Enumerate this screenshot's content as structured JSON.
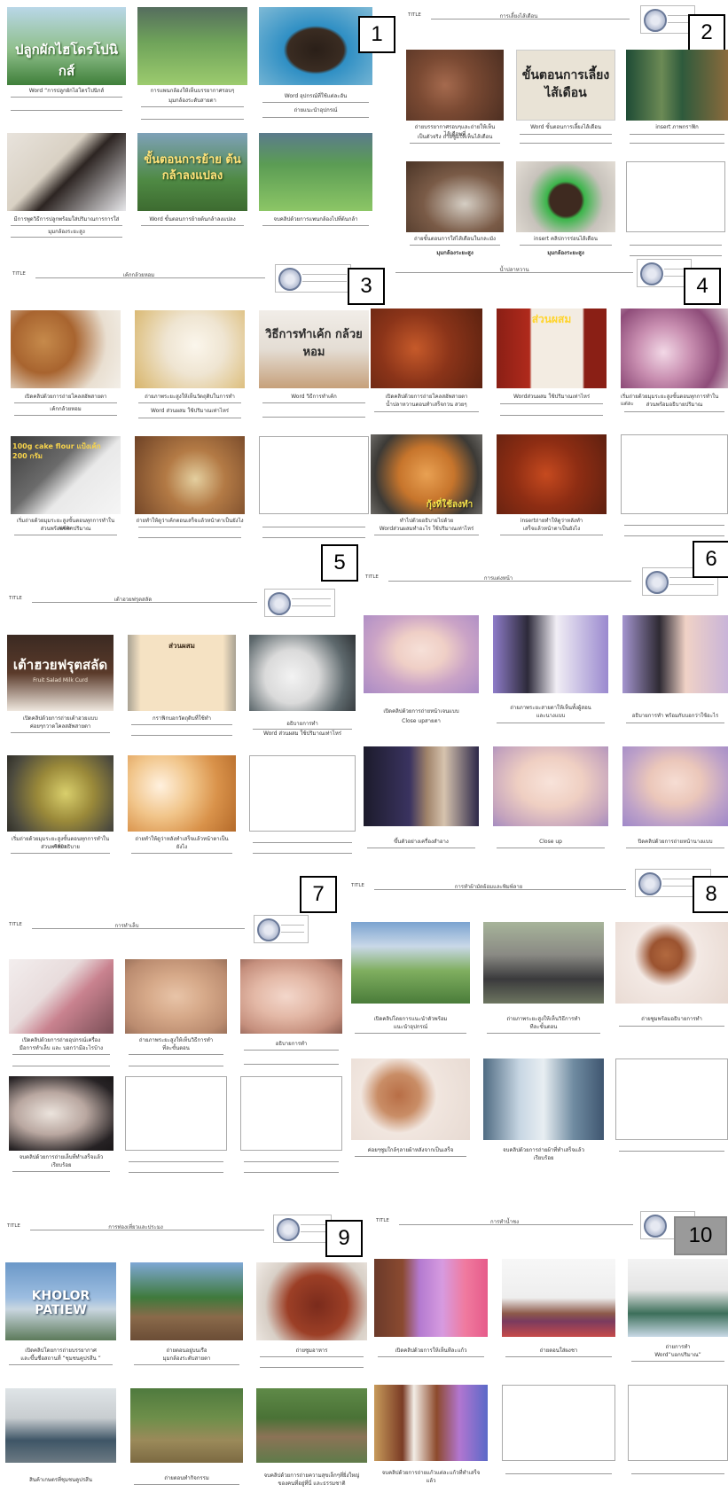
{
  "panel_numbers": [
    "1",
    "2",
    "3",
    "4",
    "5",
    "6",
    "7",
    "8",
    "9",
    "10"
  ],
  "title_label": "TITLE",
  "titles": {
    "p2": "การเลี้ยงไส้เดือน",
    "p3": "เค้กกล้วยหอม",
    "p4": "น้ำปลาหวาน",
    "p5": "เต้าฮวยฟรุตสลัด",
    "p6": "การแต่งหน้า",
    "p7": "การทำเล็บ",
    "p8": "การทำผ้ามัดย้อมและพิมพ์ลาย",
    "p9": "การท่องเที่ยวและประมง",
    "p10": "การทำน้ำชง"
  },
  "overlays": {
    "p1a": "ปลูกผักไฮโดรโปนิกส์",
    "p1d": "ขั้นตอนการย้าย ต้นกล้าลงแปลง",
    "p2b": "ขั้นตอนการเลี้ยง ไส้เดือน",
    "p3c": "วิธีการทำเค้ก กล้วยหอม",
    "p3d": "100g cake flour แป้งเค้ก 200 กรัม",
    "p4b": "ส่วนผสม",
    "p4e": "กุ้งที่ใช้ลงทำ",
    "p5a": "เต้าฮวยฟรุตสลัด",
    "p5a2": "Fruit Salad Milk Curd",
    "p5b": "ส่วนผสม",
    "p9a": "KHOLOR PATIEW"
  },
  "captions": {
    "p1a": "Word “การปลูกผักไฮโดรโปนิกส์",
    "p1b": "การแพนกล้องให้เห็นบรรยากาศรอบๆ",
    "p1b2": "มุมกล้องระดับสายตา",
    "p1c": "Word อุปกรณ์ที่ใช้แต่ละอัน",
    "p1c2": "ถ่ายแนะนำอุปกรณ์",
    "p1d": "มีการพูดวิธีการปลูกพร้อมใส่ปริมาณการการใส่",
    "p1d2": "มุมกล้องระยะสูง",
    "p1e": "Word ขั้นตอนการย้ายต้นกล้าลงแปลง",
    "p1f": "จบคลิปด้วยการแพนกล้องไปที่ต้นกล้า",
    "p2a": "ถ่ายบรรยากาศรอบๆและถ่ายให้เห็นไส้เดือนที่",
    "p2a2": "เป็นตัวจริง ถ่ายซูมให้เห็นไส้เดือน",
    "p2b": "Word ขั้นตอนการเลี้ยงไส้เดือน",
    "p2c": "insert ภาพกราฟิก",
    "p2d": "ถ่ายขั้นตอนการใส่ไส้เดือนในกละมัง",
    "p2d2": "มุมกล้องระยะสูง",
    "p2e": "insert คลิปการร่อนไส้เดือน",
    "p2e2": "มุมกล้องระยะสูง",
    "p3a": "เปิดคลิปด้วยการถ่ายโคลสอัพสายตา",
    "p3a2": "เค้กกล้วยหอม",
    "p3b": "ถ่ายภาพระยะสูงให้เห็นวัตถุดิบในการทำ",
    "p3b2": "Word ส่วนผสม ใช้ปริมาณเท่าไหร่",
    "p3c": "Word วิธีการทำเค้ก",
    "p3d": "เริ่มถ่ายด้วยมุมระยะสูงขั้นตอนทุกการทำในแต่ละ",
    "p3d2": "ส่วนพร้อมบอกปริมาณ",
    "p3e": "ถ่ายทำให้ดูว่าเค้กตอนเสร็จแล้วหน้าตาเป็นยังไง",
    "p4a": "เปิดคลิปด้วยการถ่ายโคลสอัพสายตา",
    "p4a2": "น้ำปลาหวานตอนทำเสร็จกวน สวยๆ",
    "p4b": "Wordส่วนผสม ใช้ปริมาณเท่าไหร่",
    "p4c": "เริ่มถ่ายด้วยมุมระยะสูงขั้นตอนทุกการทำในแต่ละ",
    "p4c2": "ส่วนพร้อมอธิบายปริมาณ",
    "p4d": "ทำไปด้วยอธิบายไปด้วย",
    "p4d2": "Wordส่วนผสมทำอะไร ใช้ปริมาณเท่าไหร่",
    "p4e": "insertถ่ายทำให้ดูว่าหลังทำ",
    "p4e2": "เสร็จแล้วหน้าตาเป็นยังไง",
    "p5a": "เปิดคลิปด้วยการถ่ายเต้าฮวยแบบ",
    "p5a2": "ค่อยๆกวาดโคลสอัพสายตา",
    "p5b": "กราฟิกบอกวัตถุดิบที่ใช้ทำ",
    "p5c": "อธิบายการทำ",
    "p5c2": "Word ส่วนผสม ใช้ปริมาณเท่าไหร่",
    "p5d": "เริ่มถ่ายด้วยมุมระยะสูงขั้นตอนทุกการทำในแต่ละ",
    "p5d2": "ส่วนพร้อมอธิบาย",
    "p5e": "ถ่ายทำให้ดูว่าหลังทำเสร็จแล้วหน้าตาเป็น",
    "p5e2": "ยังไง",
    "p6a": "เปิดคลิปด้วยการถ่ายหน้าเจนแบบ",
    "p6a2": "Close upสายตา",
    "p6b": "ถ่ายภาพระยะสายตาให้เห็นทั้งผู้สอน",
    "p6b2": "และนางแบบ",
    "p6c": "อธิบายการทำ พร้อมกับบอกว่าใช้อะไร",
    "p6d": "ขึ้นตัวอย่างเครื่องสำอาง",
    "p6e": "Close up",
    "p6f": "ปิดคลิปด้วยการถ่ายหน้านางแบบ",
    "p7a": "เปิดคลิปด้วยการถ่ายอุปกรณ์เครื่อง",
    "p7a2": "มือการทำเล็บ และ บอกว่ามีอะไรบ้าง",
    "p7b": "ถ่ายภาพระยะสูงให้เห็นวิธีการทำ",
    "p7b2": "ที่ละขั้นตอน",
    "p7c": "อธิบายการทำ",
    "p7d": "จบคลิปด้วยการถ่ายเล็บที่ทำเสร็จแล้ว",
    "p7d2": "เรียบร้อย",
    "p8a": "เปิดคลิปโดยการแนะนำตัวพร้อม",
    "p8a2": "แนะนำอุปกรณ์",
    "p8b": "ถ่ายภาพระยะสูงให้เห็นวิธีการทำ",
    "p8b2": "ทีละขั้นตอน",
    "p8c": "ถ่ายซูมพร้อมอธิบายการทำ",
    "p8d": "ค่อยๆซูมใกล้ๆลายผ้าหลังจากเป็นเสร็จ",
    "p8e": "จบคลิปด้วยการถ่ายผ้าที่ทำเสร็จแล้ว",
    "p8e2": "เรียบร้อย",
    "p9a": "เปิดคลิปโดยการถ่ายบรรยากาศ",
    "p9a2": "และขึ้นชื่อสถานที่ “ชุมชนคูปรสีน ”",
    "p9b": "ถ่ายตอนอยู่บนเรือ",
    "p9b2": "มุมกล้องระดับสายตา",
    "p9c": "ถ่ายซูมอาหาร",
    "p9d": "สินค้าเกษตรที่ชุมชนคูปรสีน",
    "p9e": "ถ่ายตอนทำกิจกรรม",
    "p9f": "จบคลิปด้วยการถ่ายความสุขเล็กๆที่ยิ่งใหญ่",
    "p9f2": "ของคนที่อยู่ที่นี่ และธรรมชาติ",
    "p10a": "เปิดคลิปด้วยการให้เห็นทีละแก้ว",
    "p10b": "ถ่ายตอนใส่ผงชา",
    "p10c": "ถ่ายการทำ",
    "p10c2": "Word”บอกปริมาณ”",
    "p10d": "จบคลิปด้วยการถ่ายแก้วแต่ละแก้วที่ทำเสร็จ",
    "p10d2": "แล้ว"
  }
}
